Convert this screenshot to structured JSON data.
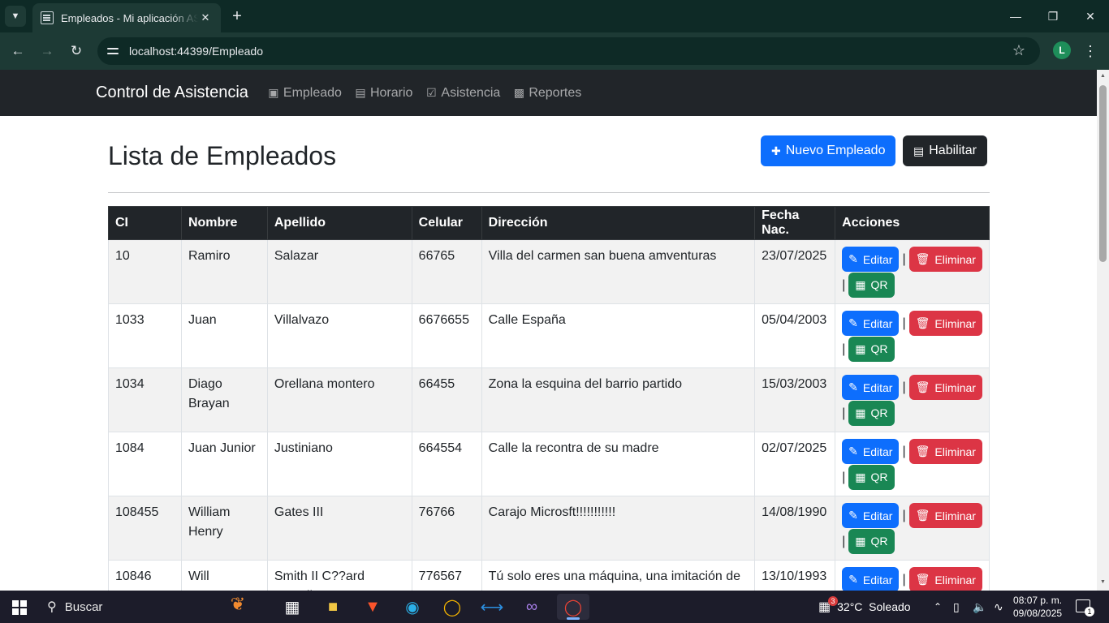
{
  "browser": {
    "tab_title": "Empleados - Mi aplicación ASP.NET",
    "url": "localhost:44399/Empleado",
    "profile_initial": "L"
  },
  "navbar": {
    "brand": "Control de Asistencia",
    "links": [
      {
        "label": "Empleado",
        "icon": "id-card-icon"
      },
      {
        "label": "Horario",
        "icon": "calendar-icon"
      },
      {
        "label": "Asistencia",
        "icon": "check-square-icon"
      },
      {
        "label": "Reportes",
        "icon": "bar-chart-icon"
      }
    ]
  },
  "page": {
    "title": "Lista de Empleados",
    "new_button": "Nuevo Empleado",
    "enable_button": "Habilitar"
  },
  "table": {
    "headers": [
      "CI",
      "Nombre",
      "Apellido",
      "Celular",
      "Dirección",
      "Fecha Nac.",
      "Acciones"
    ],
    "action_labels": {
      "edit": "Editar",
      "delete": "Eliminar",
      "qr": "QR",
      "separator": "|"
    },
    "rows": [
      {
        "ci": "10",
        "nombre": "Ramiro",
        "apellido": "Salazar",
        "celular": "66765",
        "direccion": "Villa del carmen san buena amventuras",
        "fecha": "23/07/2025"
      },
      {
        "ci": "1033",
        "nombre": "Juan",
        "apellido": "Villalvazo",
        "celular": "6676655",
        "direccion": "Calle España",
        "fecha": "05/04/2003"
      },
      {
        "ci": "1034",
        "nombre": "Diago Brayan",
        "apellido": "Orellana montero",
        "celular": "66455",
        "direccion": "Zona la esquina del barrio partido",
        "fecha": "15/03/2003"
      },
      {
        "ci": "1084",
        "nombre": "Juan Junior",
        "apellido": "Justiniano",
        "celular": "664554",
        "direccion": "Calle la recontra de su madre",
        "fecha": "02/07/2025"
      },
      {
        "ci": "108455",
        "nombre": "William Henry",
        "apellido": "Gates III",
        "celular": "76766",
        "direccion": "Carajo Microsft!!!!!!!!!!!",
        "fecha": "14/08/1990"
      },
      {
        "ci": "10846",
        "nombre": "Will",
        "apellido": "Smith II C??ard Carroll",
        "celular": "776567",
        "direccion": "Tú solo eres una máquina, una imitación de",
        "fecha": "13/10/1993"
      }
    ]
  },
  "taskbar": {
    "search_placeholder": "Buscar",
    "weather": "32°C  Soleado",
    "weather_badge": "3",
    "time": "08:07 p. m.",
    "date": "09/08/2025",
    "notification_count": "1"
  }
}
